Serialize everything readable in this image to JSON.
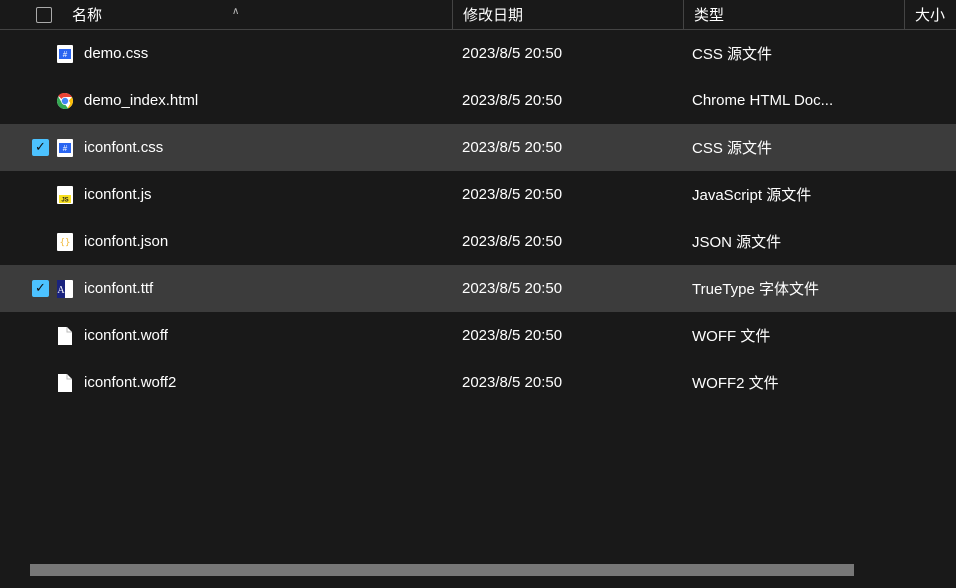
{
  "header": {
    "name": "名称",
    "date": "修改日期",
    "type": "类型",
    "size": "大小"
  },
  "files": [
    {
      "icon": "css",
      "name": "demo.css",
      "date": "2023/8/5 20:50",
      "type": "CSS 源文件",
      "selected": false
    },
    {
      "icon": "chrome",
      "name": "demo_index.html",
      "date": "2023/8/5 20:50",
      "type": "Chrome HTML Doc...",
      "selected": false
    },
    {
      "icon": "css",
      "name": "iconfont.css",
      "date": "2023/8/5 20:50",
      "type": "CSS 源文件",
      "selected": true
    },
    {
      "icon": "js",
      "name": "iconfont.js",
      "date": "2023/8/5 20:50",
      "type": "JavaScript 源文件",
      "selected": false
    },
    {
      "icon": "json",
      "name": "iconfont.json",
      "date": "2023/8/5 20:50",
      "type": "JSON 源文件",
      "selected": false
    },
    {
      "icon": "ttf",
      "name": "iconfont.ttf",
      "date": "2023/8/5 20:50",
      "type": "TrueType 字体文件",
      "selected": true
    },
    {
      "icon": "file",
      "name": "iconfont.woff",
      "date": "2023/8/5 20:50",
      "type": "WOFF 文件",
      "selected": false
    },
    {
      "icon": "file",
      "name": "iconfont.woff2",
      "date": "2023/8/5 20:50",
      "type": "WOFF2 文件",
      "selected": false
    }
  ]
}
